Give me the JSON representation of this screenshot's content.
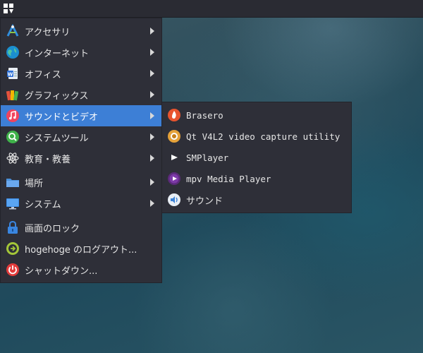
{
  "menu": {
    "items": [
      {
        "label": "アクセサリ",
        "icon": "accessories-icon",
        "submenu": true
      },
      {
        "label": "インターネット",
        "icon": "globe-icon",
        "submenu": true
      },
      {
        "label": "オフィス",
        "icon": "office-icon",
        "submenu": true
      },
      {
        "label": "グラフィックス",
        "icon": "graphics-icon",
        "submenu": true
      },
      {
        "label": "サウンドとビデオ",
        "icon": "music-icon",
        "submenu": true,
        "active": true
      },
      {
        "label": "システムツール",
        "icon": "system-tools-icon",
        "submenu": true
      },
      {
        "label": "教育・教養",
        "icon": "atom-icon",
        "submenu": true
      },
      {
        "label": "場所",
        "icon": "folder-icon",
        "submenu": true
      },
      {
        "label": "システム",
        "icon": "monitor-icon",
        "submenu": true
      },
      {
        "label": "画面のロック",
        "icon": "lock-icon",
        "submenu": false
      },
      {
        "label": "hogehoge のログアウト...",
        "icon": "logout-icon",
        "submenu": false
      },
      {
        "label": "シャットダウン...",
        "icon": "power-icon",
        "submenu": false
      }
    ]
  },
  "submenu": {
    "items": [
      {
        "label": "Brasero",
        "icon": "brasero-icon"
      },
      {
        "label": "Qt V4L2 video capture utility",
        "icon": "qv4l2-icon"
      },
      {
        "label": "SMPlayer",
        "icon": "play-icon"
      },
      {
        "label": "mpv Media Player",
        "icon": "mpv-icon"
      },
      {
        "label": "サウンド",
        "icon": "speaker-icon"
      }
    ]
  },
  "colors": {
    "highlight": "#3d7fd6",
    "menu_bg": "#2e2f38",
    "panel_bg": "#2a2b33"
  }
}
